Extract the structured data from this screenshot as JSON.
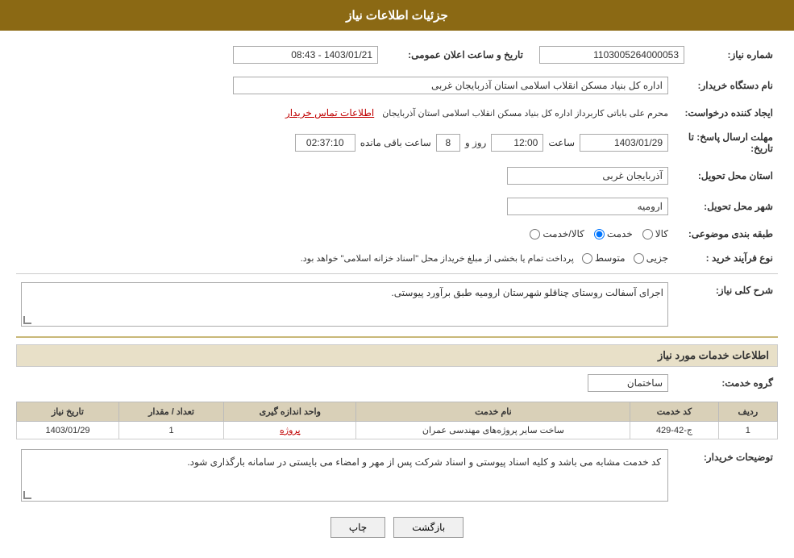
{
  "header": {
    "title": "جزئیات اطلاعات نیاز"
  },
  "fields": {
    "shomareNiaz": {
      "label": "شماره نیاز:",
      "value": "1103005264000053"
    },
    "namDastgah": {
      "label": "نام دستگاه خریدار:",
      "value": "اداره کل بنیاد مسکن انقلاب اسلامی استان آذربایجان غربی"
    },
    "ijadKonande": {
      "label": "ایجاد کننده درخواست:",
      "value": "محرم علی باباتی کاربرداز اداره کل بنیاد مسکن انقلاب اسلامی استان آذربایجان"
    },
    "tamasLink": "اطلاعات تماس خریدار",
    "mohlatErsal": {
      "label": "مهلت ارسال پاسخ: تا تاریخ:",
      "date": "1403/01/29",
      "time": "12:00",
      "roz": "8",
      "saat": "02:37:10"
    },
    "ostanTahvil": {
      "label": "استان محل تحویل:",
      "value": "آذربایجان غربی"
    },
    "shahrTahvil": {
      "label": "شهر محل تحویل:",
      "value": "ارومیه"
    },
    "tabebandiMozooee": {
      "label": "طبقه بندی موضوعی:",
      "options": [
        "کالا",
        "خدمت",
        "کالا/خدمت"
      ],
      "selected": "خدمت"
    },
    "noefarayandKharid": {
      "label": "نوع فرآیند خرید:",
      "options": [
        "جزیی",
        "متوسط"
      ],
      "selected": "",
      "description": "پرداخت تمام یا بخشی از مبلغ خریداز محل \"اسناد خزانه اسلامی\" خواهد بود."
    },
    "taarikheAlanOmomi": {
      "label": "تاریخ و ساعت اعلان عمومی:",
      "value": "1403/01/21 - 08:43"
    }
  },
  "sharhKolli": {
    "title": "شرح کلی نیاز:",
    "value": "اجرای آسفالت روستای چناقلو شهرستان ارومیه طبق برآورد پیوستی."
  },
  "servicesInfo": {
    "title": "اطلاعات خدمات مورد نیاز",
    "groupLabel": "گروه خدمت:",
    "groupValue": "ساختمان",
    "tableHeaders": [
      "ردیف",
      "کد خدمت",
      "نام خدمت",
      "واحد اندازه گیری",
      "تعداد / مقدار",
      "تاریخ نیاز"
    ],
    "rows": [
      {
        "radif": "1",
        "kodKhedmat": "ج-42-429",
        "namKhedmat": "ساخت سایر پروژه‌های مهندسی عمران",
        "vahed": "پروژه",
        "tedad": "1",
        "tarikhNiaz": "1403/01/29"
      }
    ]
  },
  "tosihaat": {
    "label": "توضیحات خریدار:",
    "value": "کد خدمت مشابه می باشد و کلیه اسناد پیوستی و اسناد شرکت پس از مهر و امضاء می بایستی در سامانه بارگذاری شود."
  },
  "buttons": {
    "print": "چاپ",
    "back": "بازگشت"
  }
}
